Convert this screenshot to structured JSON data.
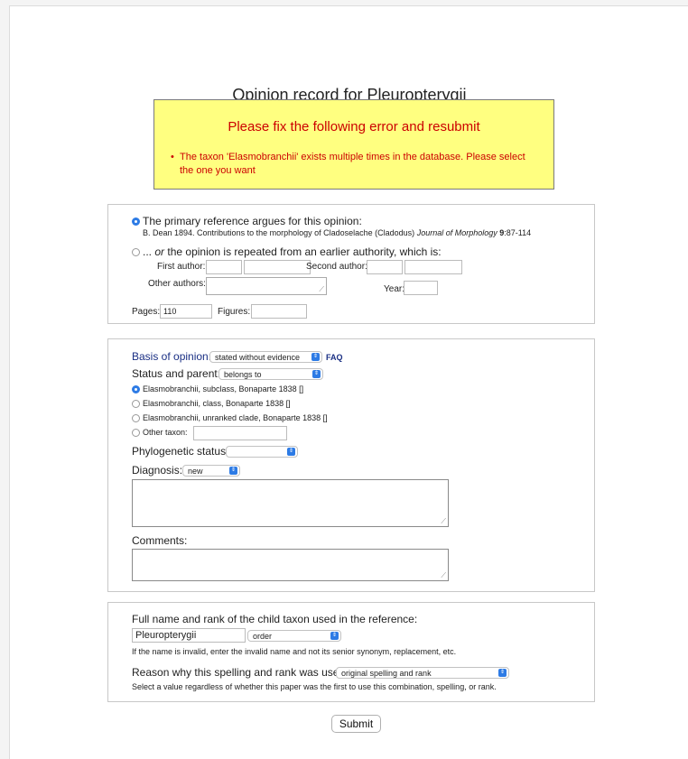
{
  "page_title": "Opinion record for Pleuropterygii",
  "error": {
    "title": "Please fix the following error and resubmit",
    "messages": [
      "The taxon 'Elasmobranchii' exists multiple times in the database. Please select the one you want"
    ]
  },
  "reference": {
    "primary_label": "The primary reference argues for this opinion:",
    "primary_citation_text": "B. Dean 1894. Contributions to the morphology of Cladoselache (Cladodus)",
    "primary_journal": "Journal of Morphology",
    "primary_volume": "9",
    "primary_pages": ":87-114",
    "earlier_prefix": "...",
    "earlier_or": "or",
    "earlier_label": "the opinion is repeated from an earlier authority, which is:",
    "first_author_label": "First author:",
    "second_author_label": "Second author:",
    "other_authors_label": "Other authors:",
    "year_label": "Year:",
    "pages_label": "Pages:",
    "pages_value": "110",
    "figures_label": "Figures:"
  },
  "opinion": {
    "basis_label": "Basis of opinion:",
    "basis_value": "stated without evidence",
    "faq_link": "FAQ",
    "status_label": "Status and parent:",
    "status_value": "belongs to",
    "parent_options": [
      "Elasmobranchii, subclass, Bonaparte 1838 []",
      "Elasmobranchii, class, Bonaparte 1838 []",
      "Elasmobranchii, unranked clade, Bonaparte 1838 []"
    ],
    "other_taxon_label": "Other taxon:",
    "phylogenetic_label": "Phylogenetic status:",
    "phylogenetic_value": "",
    "diagnosis_label": "Diagnosis:",
    "diagnosis_value": "new",
    "comments_label": "Comments:"
  },
  "child": {
    "heading": "Full name and rank of the child taxon used in the reference:",
    "name_value": "Pleuropterygii",
    "rank_value": "order",
    "invalid_note": "If the name is invalid, enter the invalid name and not its senior synonym, replacement, etc.",
    "reason_label": "Reason why this spelling and rank was used:",
    "reason_value": "original spelling and rank",
    "reason_note": "Select a value regardless of whether this paper was the first to use this combination, spelling, or rank."
  },
  "submit_label": "Submit",
  "colors": {
    "error_background": "#ffff80",
    "error_text": "#cc0000",
    "label_navy": "#1a2f84",
    "radio_selected": "#2d7be5"
  }
}
